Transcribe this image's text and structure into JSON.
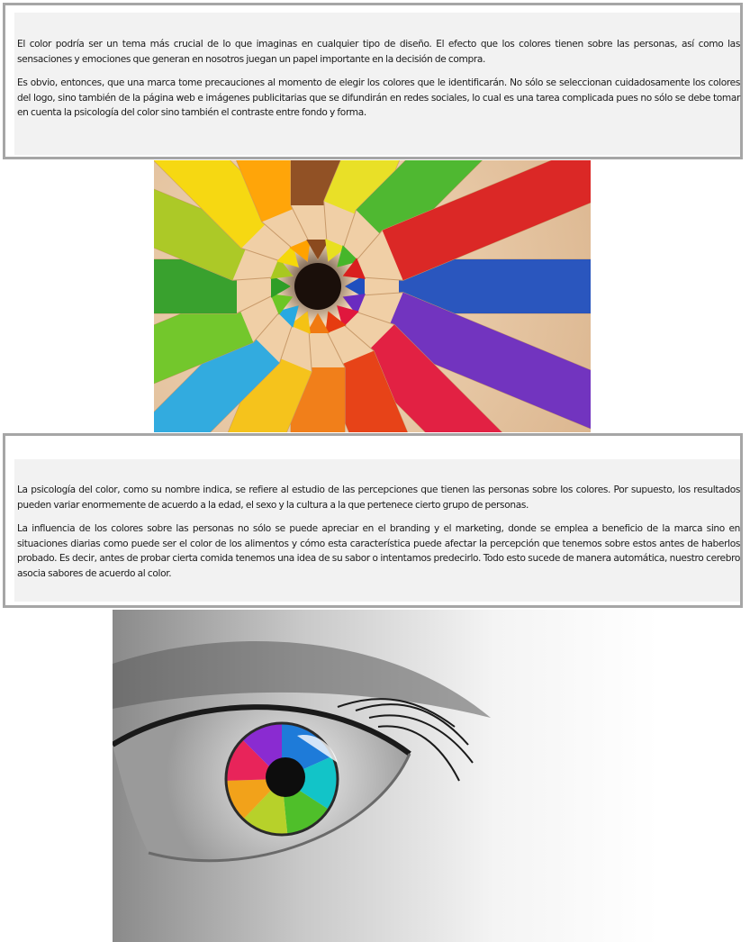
{
  "article": {
    "section1": {
      "p1": "El color podría ser un tema más crucial de lo que imaginas en cualquier tipo de diseño. El efecto que los colores tienen sobre las personas, así como las sensaciones y emociones que generan en nosotros juegan un papel importante en la decisión de compra.",
      "p2": "Es obvio, entonces, que una marca tome precauciones al momento de elegir los colores que le identificarán. No sólo se seleccionan cuidadosamente los colores del logo, sino también de la página web e imágenes publicitarias que se difundirán en redes sociales, lo cual es una tarea complicada pues no sólo se debe tomar en cuenta la psicología del color sino también el contraste entre fondo y forma."
    },
    "section2": {
      "p1": "La psicología del color, como su nombre indica, se refiere al estudio de las percepciones que tienen las personas sobre los colores. Por supuesto, los resultados pueden variar enormemente de acuerdo a la edad, el sexo y la cultura a la que pertenece cierto grupo de personas.",
      "p2": "La influencia de los colores sobre las personas no sólo se puede apreciar en el branding y el marketing, donde se emplea a beneficio de la marca sino en situaciones diarias como puede ser el color de los alimentos y cómo esta característica puede afectar la percepción que tenemos sobre estos antes de haberlos probado. Es decir, antes de probar cierta comida tenemos una idea de su sabor o intentamos predecirlo. Todo esto sucede de manera automática, nuestro cerebro asocia sabores de acuerdo al color."
    }
  },
  "colors": {
    "box_border": "#a6a6a6",
    "box_fill": "#f2f2f2",
    "text": "#1a1a1a"
  }
}
